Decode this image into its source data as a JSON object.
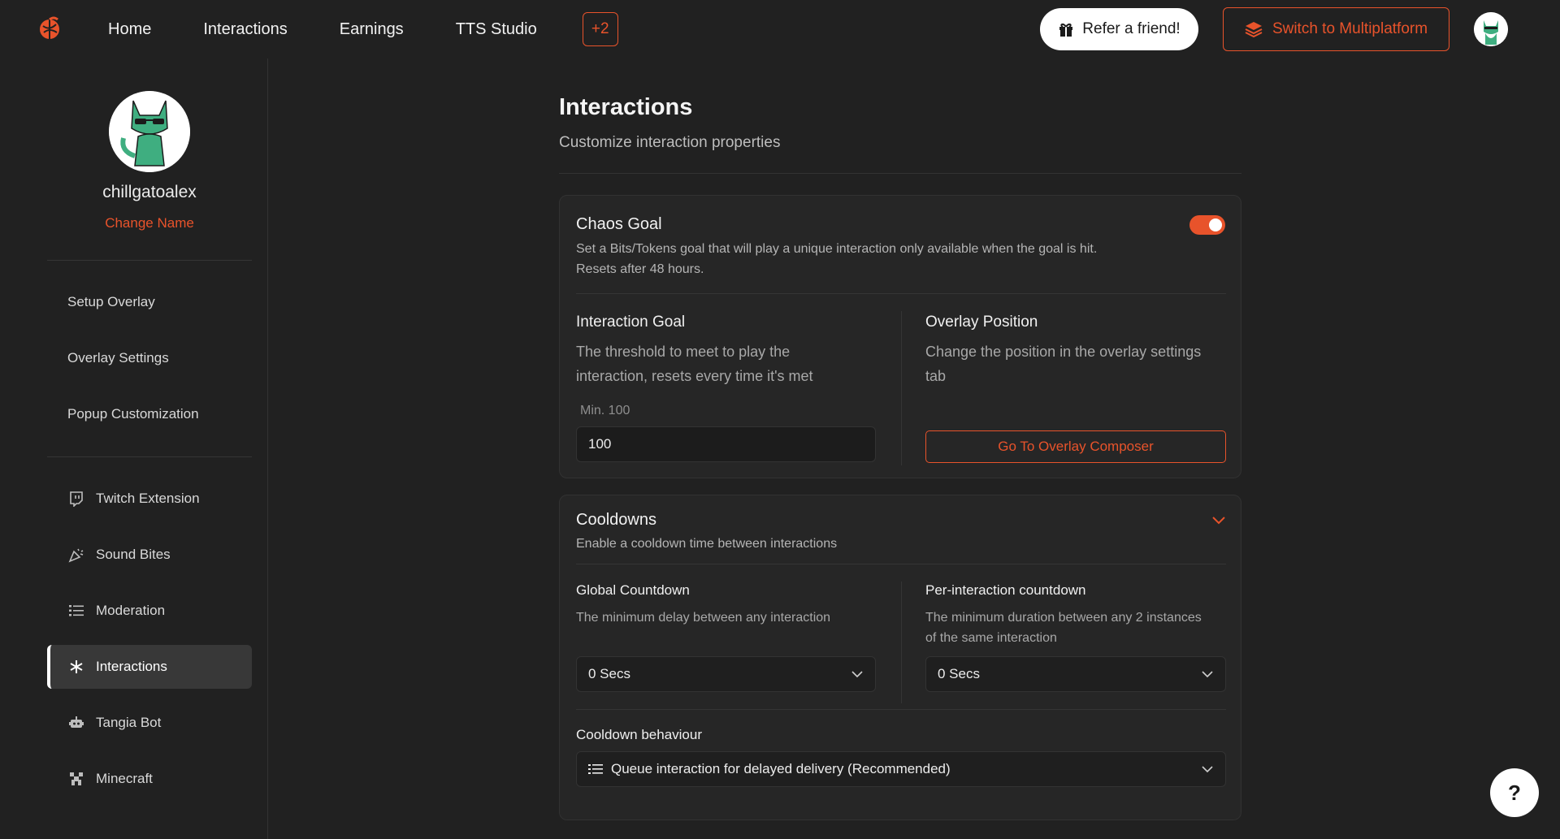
{
  "nav": {
    "items": [
      "Home",
      "Interactions",
      "Earnings",
      "TTS Studio"
    ],
    "more": "+2",
    "refer_label": "Refer a friend!",
    "multiplatform_label": "Switch to Multiplatform"
  },
  "profile": {
    "username": "chillgatoalex",
    "change_name": "Change Name"
  },
  "sidebar": {
    "group1": [
      "Setup Overlay",
      "Overlay Settings",
      "Popup Customization"
    ],
    "group2": [
      {
        "label": "Twitch Extension",
        "icon": "twitch-icon"
      },
      {
        "label": "Sound Bites",
        "icon": "party-horn-icon"
      },
      {
        "label": "Moderation",
        "icon": "list-icon"
      },
      {
        "label": "Interactions",
        "icon": "asterisk-icon"
      },
      {
        "label": "Tangia Bot",
        "icon": "robot-icon"
      },
      {
        "label": "Minecraft",
        "icon": "creeper-icon"
      }
    ],
    "active": "Interactions"
  },
  "main": {
    "title": "Interactions",
    "subtitle": "Customize interaction properties"
  },
  "chaos": {
    "title": "Chaos Goal",
    "desc1": "Set a Bits/Tokens goal that will play a unique interaction only available when the goal is hit.",
    "desc2": "Resets after 48 hours.",
    "enabled": true,
    "goal_title": "Interaction Goal",
    "goal_desc1": "The threshold to meet to play the",
    "goal_desc2": "interaction, resets every time it's met",
    "goal_hint": "Min. 100",
    "goal_value": "100",
    "pos_title": "Overlay Position",
    "pos_desc1": "Change the position in the overlay settings",
    "pos_desc2": "tab",
    "composer_label": "Go To Overlay Composer"
  },
  "cooldowns": {
    "title": "Cooldowns",
    "desc": "Enable a cooldown time between interactions",
    "global_title": "Global Countdown",
    "global_desc": "The minimum delay between any interaction",
    "global_value": "0 Secs",
    "per_title": "Per-interaction countdown",
    "per_desc1": "The minimum duration between any 2 instances",
    "per_desc2": "of the same interaction",
    "per_value": "0 Secs",
    "behaviour_title": "Cooldown behaviour",
    "behaviour_value": "Queue interaction for delayed delivery (Recommended)"
  },
  "help": {
    "label": "?"
  },
  "colors": {
    "accent": "#e8532b",
    "background": "#212121",
    "card": "#262626"
  }
}
